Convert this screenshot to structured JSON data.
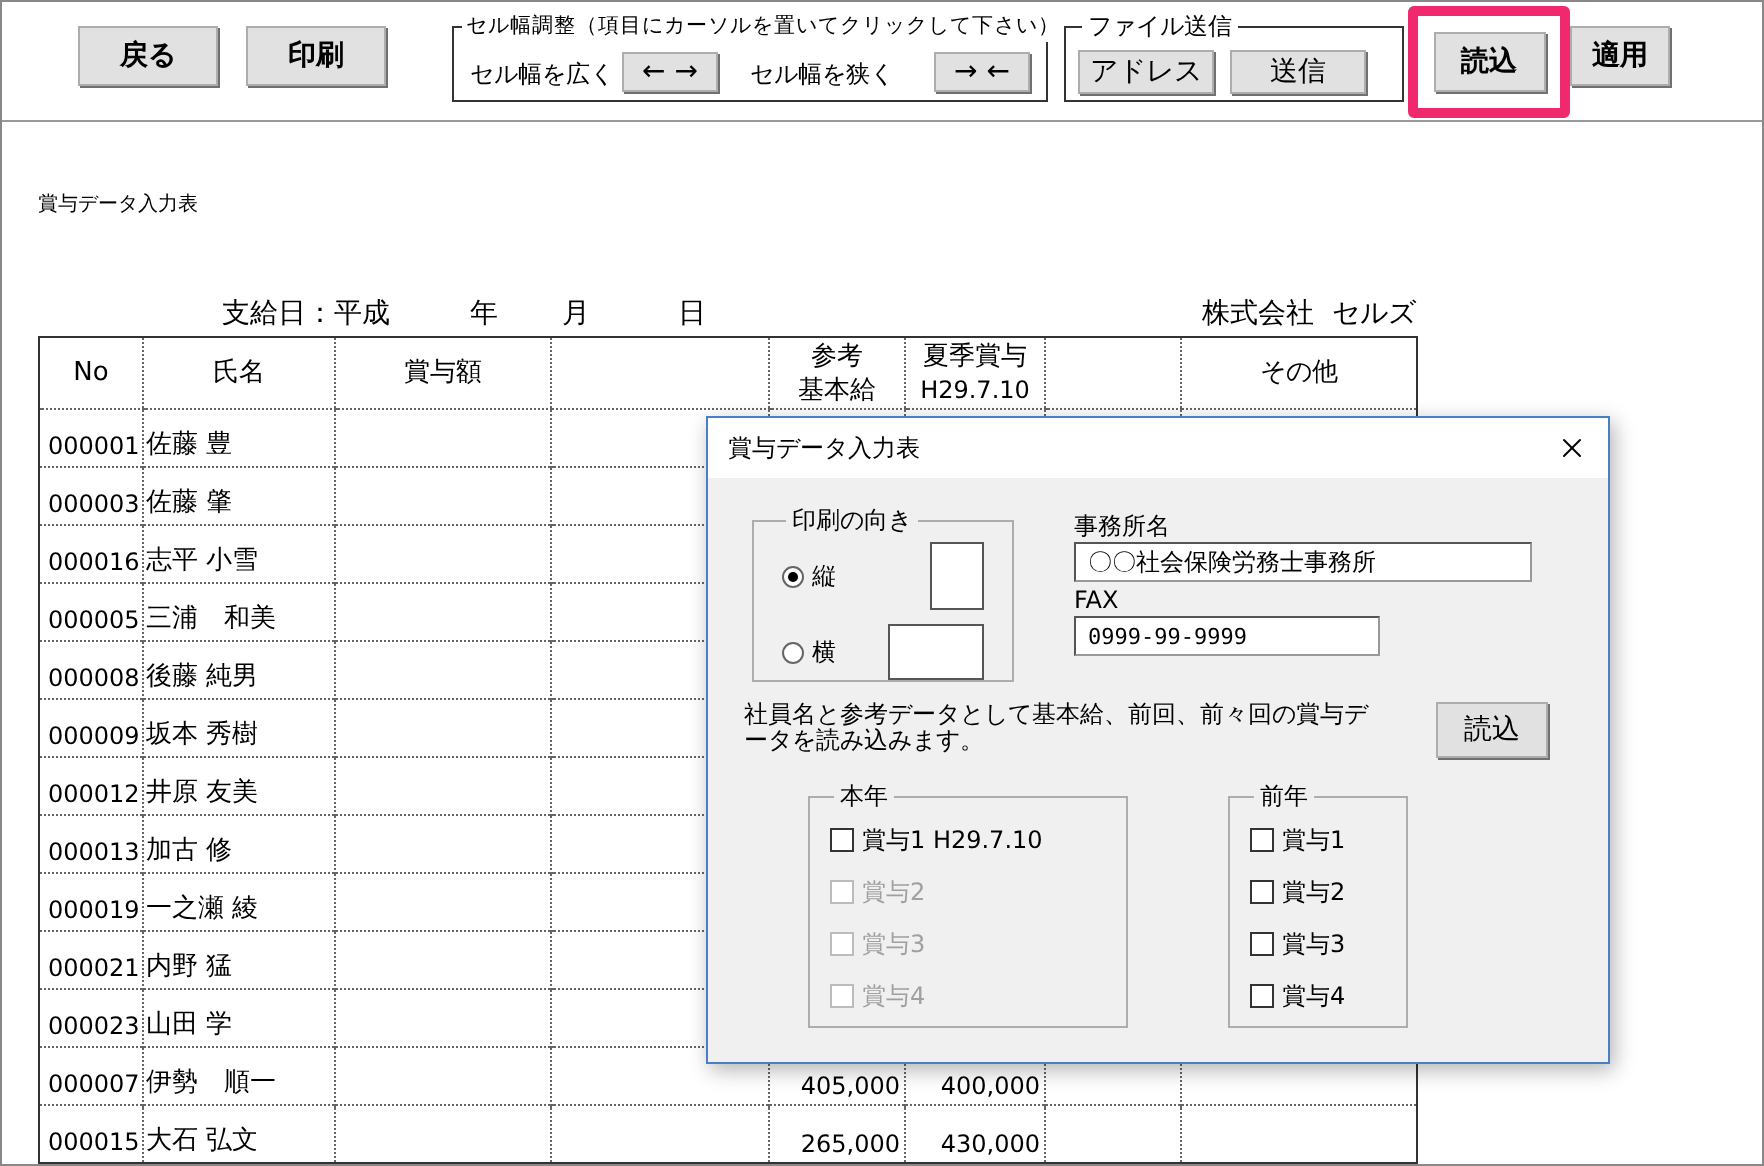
{
  "toolbar": {
    "buttons": [
      {
        "label": "戻る"
      },
      {
        "label": "印刷"
      }
    ],
    "cell_width": {
      "title": "セル幅調整（項目にカーソルを置いてクリックして下さい）",
      "widen_label": "セル幅を広く",
      "widen_button": "← →",
      "narrow_label": "セル幅を狭く",
      "narrow_button": "→ ←"
    },
    "file_send": {
      "title": "ファイル送信",
      "buttons": [
        {
          "label": "アドレス"
        },
        {
          "label": "送信"
        }
      ]
    },
    "load_button": {
      "label": "読込",
      "highlighted": true
    },
    "apply_button": {
      "label": "適用"
    }
  },
  "sheet": {
    "caption": "賞与データ入力表",
    "pay_date": {
      "label": "支給日：平成",
      "year": "年",
      "month": "月",
      "day": "日"
    },
    "company": "株式会社  セルズ",
    "columns": [
      {
        "lines": [
          "No"
        ]
      },
      {
        "lines": [
          "氏名"
        ]
      },
      {
        "lines": [
          "賞与額"
        ]
      },
      {},
      {
        "lines": [
          "参考",
          "基本給"
        ]
      },
      {
        "lines": [
          "夏季賞与",
          "H29.7.10"
        ]
      },
      {},
      {
        "lines": [
          "その他"
        ]
      }
    ],
    "rows": [
      {
        "no": "000001",
        "name": "佐藤 豊"
      },
      {
        "no": "000003",
        "name": "佐藤 肇"
      },
      {
        "no": "000016",
        "name": "志平 小雪"
      },
      {
        "no": "000005",
        "name": "三浦　和美"
      },
      {
        "no": "000008",
        "name": "後藤 純男"
      },
      {
        "no": "000009",
        "name": "坂本 秀樹"
      },
      {
        "no": "000012",
        "name": "井原 友美"
      },
      {
        "no": "000013",
        "name": "加古 修"
      },
      {
        "no": "000019",
        "name": "一之瀬 綾"
      },
      {
        "no": "000021",
        "name": "内野 猛"
      },
      {
        "no": "000023",
        "name": "山田 学"
      },
      {
        "no": "000007",
        "name": "伊勢　順一",
        "base": "405,000",
        "summer": "400,000"
      },
      {
        "no": "000015",
        "name": "大石 弘文",
        "base": "265,000",
        "summer": "430,000"
      }
    ]
  },
  "dialog": {
    "title": "賞与データ入力表",
    "orientation": {
      "title": "印刷の向き",
      "options": [
        {
          "label": "縦",
          "kind": "portrait",
          "selected": true
        },
        {
          "label": "横",
          "kind": "landscape",
          "selected": false
        }
      ]
    },
    "office": {
      "label": "事務所名",
      "value": "〇〇社会保険労務士事務所"
    },
    "fax": {
      "label": "FAX",
      "value": "0999-99-9999"
    },
    "description": "社員名と参考データとして基本給、前回、前々回の賞与データを読み込みます。",
    "load_button": "読込",
    "groups": [
      {
        "title": "本年",
        "items": [
          {
            "label": "賞与1 H29.7.10",
            "checked": false,
            "disabled": false
          },
          {
            "label": "賞与2",
            "checked": false,
            "disabled": true
          },
          {
            "label": "賞与3",
            "checked": false,
            "disabled": true
          },
          {
            "label": "賞与4",
            "checked": false,
            "disabled": true
          }
        ]
      },
      {
        "title": "前年",
        "items": [
          {
            "label": "賞与1",
            "checked": false,
            "disabled": false
          },
          {
            "label": "賞与2",
            "checked": false,
            "disabled": false
          },
          {
            "label": "賞与3",
            "checked": false,
            "disabled": false
          },
          {
            "label": "賞与4",
            "checked": false,
            "disabled": false
          }
        ]
      }
    ]
  }
}
